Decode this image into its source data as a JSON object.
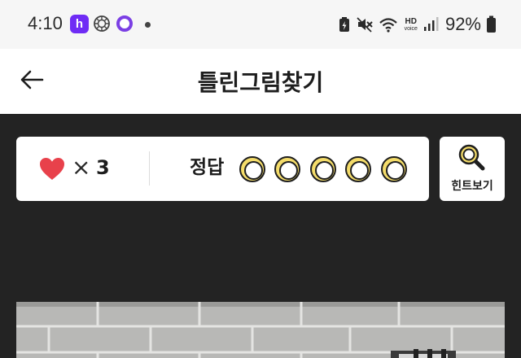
{
  "status_bar": {
    "time": "4:10",
    "notification_icons": [
      "h-app-icon",
      "gear-icon",
      "ring-app-icon",
      "dot"
    ],
    "system_icons": [
      "battery-saver-icon",
      "mute-icon",
      "wifi-icon",
      "hd-voice-icon",
      "signal-icon",
      "battery-icon"
    ],
    "hd_label": "HD",
    "voice_label": "voice",
    "battery_percent": "92%"
  },
  "header": {
    "back_icon": "arrow-left-icon",
    "title": "틀린그림찾기"
  },
  "scoreboard": {
    "lives_icon": "heart-icon",
    "times_sign": "×",
    "lives": "3",
    "answer_label": "정답",
    "answer_slots_total": 5,
    "answer_slots_found": 0
  },
  "hint_button": {
    "icon": "magnifier-icon",
    "label": "힌트보기"
  },
  "colors": {
    "status_bg": "#f6f6f6",
    "header_bg": "#ffffff",
    "game_bg": "#232323",
    "heart": "#e8414b",
    "slot_yellow": "#f4dc6a",
    "h_app": "#6f2cf5"
  }
}
